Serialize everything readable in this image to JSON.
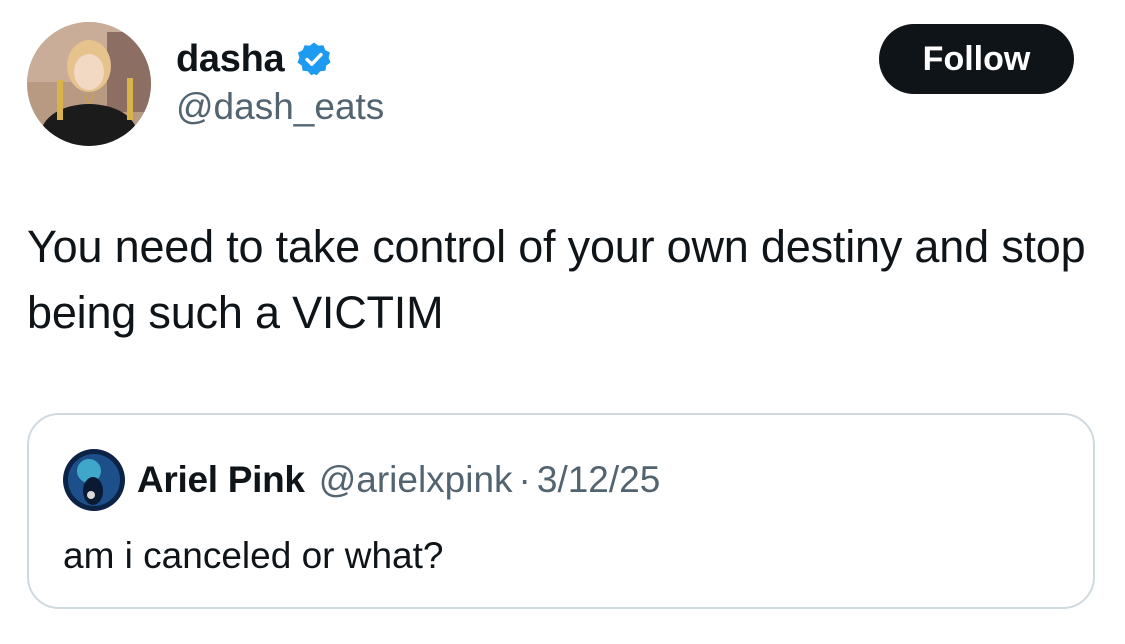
{
  "author": {
    "name": "dasha",
    "handle": "@dash_eats",
    "verified": true,
    "avatar_icon": "user-avatar"
  },
  "follow_label": "Follow",
  "tweet_text": "You need to take control of your own destiny and stop being such a VICTIM",
  "quoted_tweet": {
    "name": "Ariel Pink",
    "handle": "@arielxpink",
    "separator": "·",
    "date": "3/12/25",
    "text": "am i canceled or what?",
    "avatar_icon": "user-avatar"
  },
  "colors": {
    "text_primary": "#0f1419",
    "text_secondary": "#536471",
    "verified_blue": "#1d9bf0",
    "follow_bg": "#0f1419",
    "follow_text": "#ffffff",
    "card_border": "#cfd9de"
  }
}
